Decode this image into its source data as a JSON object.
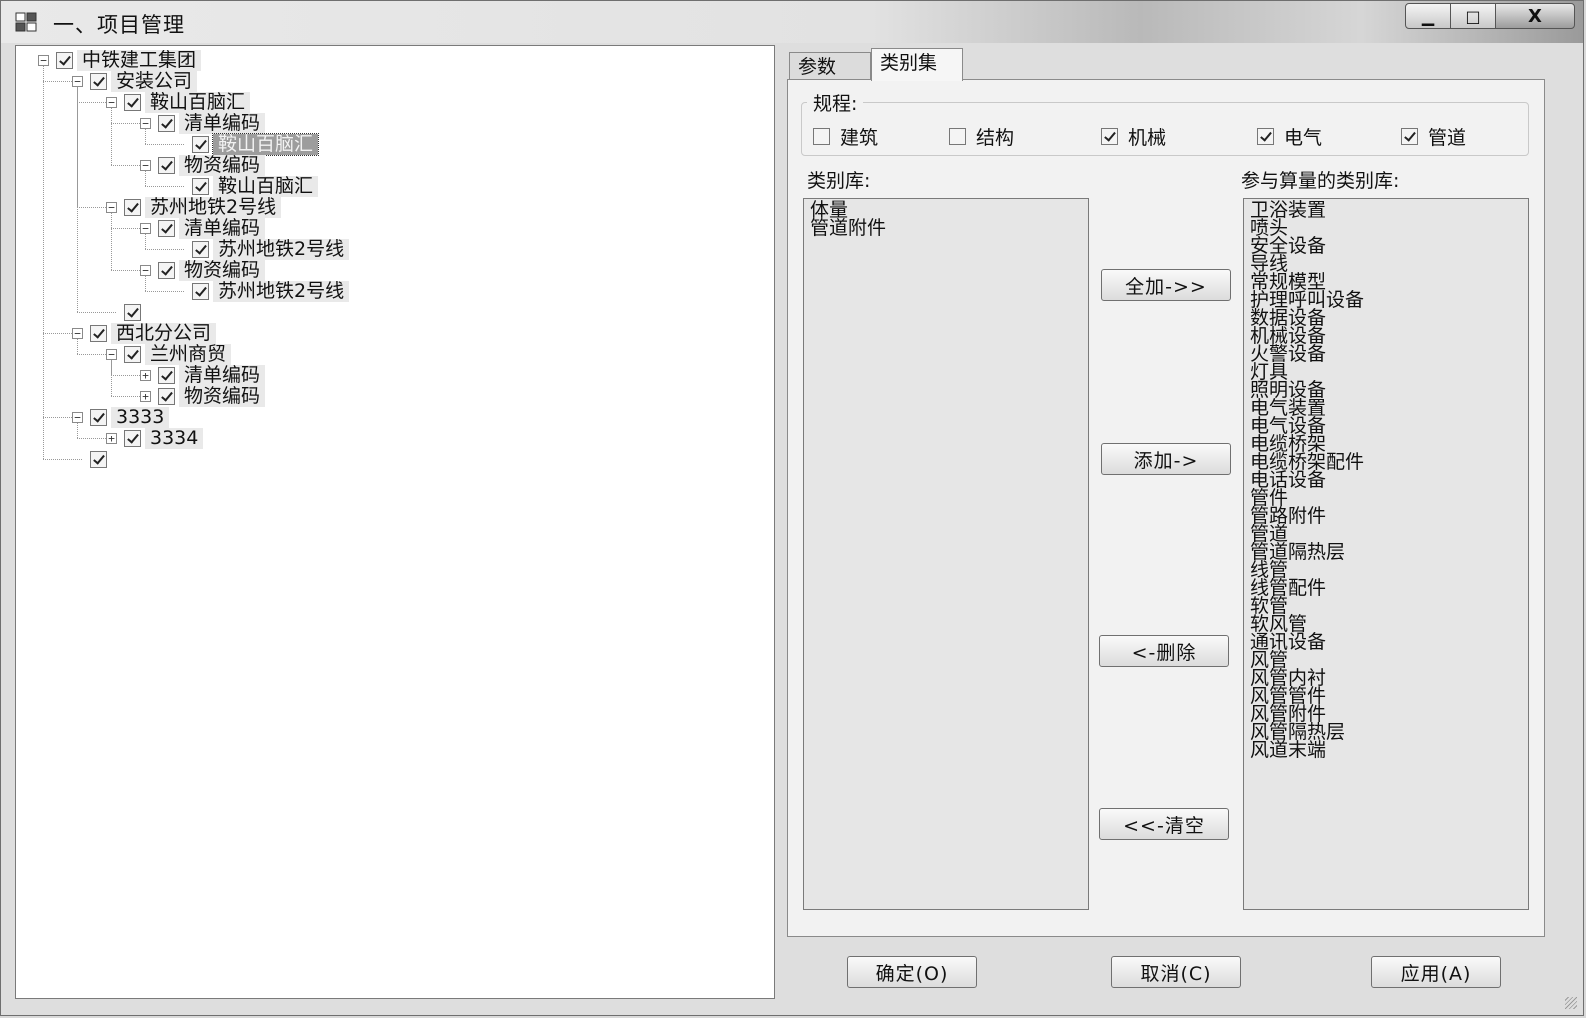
{
  "window": {
    "title": "一、项目管理",
    "controls": {
      "minimize": "▁",
      "maximize": "□",
      "close": "X"
    }
  },
  "tree": {
    "nodes": [
      {
        "label": "中铁建工集团",
        "level": 0,
        "expander": "−",
        "checked": true
      },
      {
        "label": "安装公司",
        "level": 1,
        "expander": "−",
        "checked": true
      },
      {
        "label": "鞍山百脑汇",
        "level": 2,
        "expander": "−",
        "checked": true
      },
      {
        "label": "清单编码",
        "level": 3,
        "expander": "−",
        "checked": true
      },
      {
        "label": "鞍山百脑汇",
        "level": 4,
        "expander": "",
        "checked": true,
        "selected": true
      },
      {
        "label": "物资编码",
        "level": 3,
        "expander": "−",
        "checked": true
      },
      {
        "label": "鞍山百脑汇",
        "level": 4,
        "expander": "",
        "checked": true
      },
      {
        "label": "苏州地铁2号线",
        "level": 2,
        "expander": "−",
        "checked": true
      },
      {
        "label": "清单编码",
        "level": 3,
        "expander": "−",
        "checked": true
      },
      {
        "label": "苏州地铁2号线",
        "level": 4,
        "expander": "",
        "checked": true
      },
      {
        "label": "物资编码",
        "level": 3,
        "expander": "−",
        "checked": true
      },
      {
        "label": "苏州地铁2号线",
        "level": 4,
        "expander": "",
        "checked": true
      },
      {
        "label": "",
        "level": 2,
        "expander": "",
        "checked": true
      },
      {
        "label": "西北分公司",
        "level": 1,
        "expander": "−",
        "checked": true
      },
      {
        "label": "兰州商贸",
        "level": 2,
        "expander": "−",
        "checked": true
      },
      {
        "label": "清单编码",
        "level": 3,
        "expander": "+",
        "checked": true
      },
      {
        "label": "物资编码",
        "level": 3,
        "expander": "+",
        "checked": true
      },
      {
        "label": "3333",
        "level": 1,
        "expander": "−",
        "checked": true
      },
      {
        "label": "3334",
        "level": 2,
        "expander": "+",
        "checked": true
      },
      {
        "label": "",
        "level": 1,
        "expander": "",
        "checked": true
      }
    ]
  },
  "tabs": [
    {
      "label": "参数",
      "active": false
    },
    {
      "label": "类别集",
      "active": true
    }
  ],
  "disciplines": {
    "title": "规程:",
    "items": [
      {
        "label": "建筑",
        "checked": false
      },
      {
        "label": "结构",
        "checked": false
      },
      {
        "label": "机械",
        "checked": true
      },
      {
        "label": "电气",
        "checked": true
      },
      {
        "label": "管道",
        "checked": true
      }
    ]
  },
  "category_library": {
    "label": "类别库:",
    "items": [
      "体量",
      "管道附件"
    ]
  },
  "participating_library": {
    "label": "参与算量的类别库:",
    "items": [
      "卫浴装置",
      "喷头",
      "安全设备",
      "导线",
      "常规模型",
      "护理呼叫设备",
      "数据设备",
      "机械设备",
      "火警设备",
      "灯具",
      "照明设备",
      "电气装置",
      "电气设备",
      "电缆桥架",
      "电缆桥架配件",
      "电话设备",
      "管件",
      "管路附件",
      "管道",
      "管道隔热层",
      "线管",
      "线管配件",
      "软管",
      "软风管",
      "通讯设备",
      "风管",
      "风管内衬",
      "风管管件",
      "风管附件",
      "风管隔热层",
      "风道末端"
    ]
  },
  "transfer_buttons": {
    "add_all": "全加->>",
    "add": "添加->",
    "remove": "<-删除",
    "clear": "<<-清空"
  },
  "footer": {
    "ok": "确定(O)",
    "cancel": "取消(C)",
    "apply": "应用(A)"
  }
}
